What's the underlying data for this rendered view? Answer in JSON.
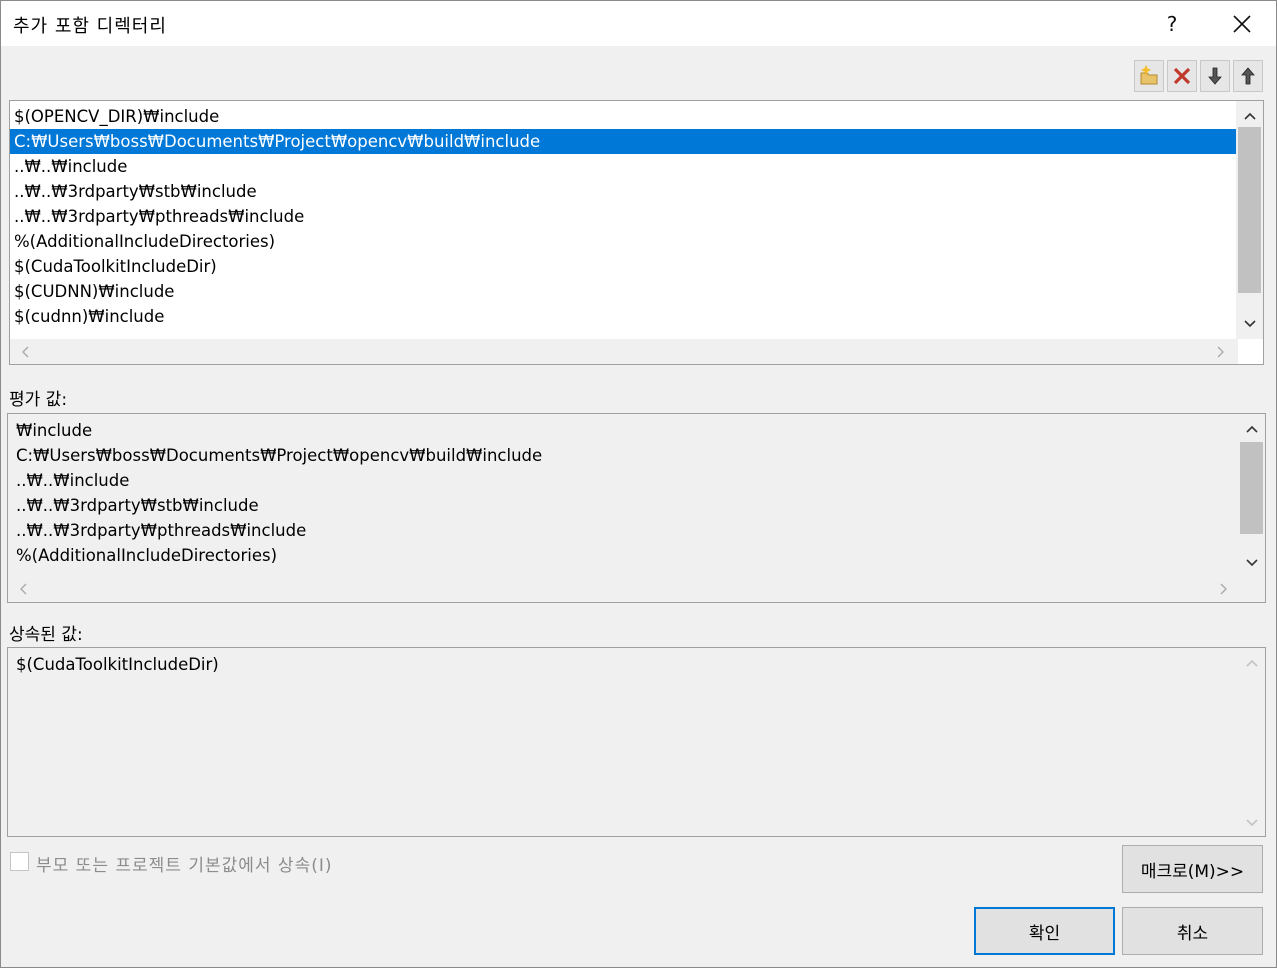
{
  "window": {
    "title": "추가 포함 디렉터리",
    "help_label": "?",
    "close_icon": "close-icon"
  },
  "toolbar": {
    "buttons": [
      {
        "name": "new-line",
        "icon": "new-folder-icon"
      },
      {
        "name": "delete",
        "icon": "delete-x-icon"
      },
      {
        "name": "move-down",
        "icon": "arrow-down-icon"
      },
      {
        "name": "move-up",
        "icon": "arrow-up-icon"
      }
    ]
  },
  "directories": {
    "items": [
      "$(OPENCV_DIR)₩include",
      "C:₩Users₩boss₩Documents₩Project₩opencv₩build₩include",
      "..₩..₩include",
      "..₩..₩3rdparty₩stb₩include",
      "..₩..₩3rdparty₩pthreads₩include",
      "%(AdditionalIncludeDirectories)",
      "$(CudaToolkitIncludeDir)",
      "$(CUDNN)₩include",
      "$(cudnn)₩include"
    ],
    "selected_index": 1
  },
  "evaluated": {
    "label": "평가 값:",
    "items": [
      "₩include",
      "C:₩Users₩boss₩Documents₩Project₩opencv₩build₩include",
      "..₩..₩include",
      "..₩..₩3rdparty₩stb₩include",
      "..₩..₩3rdparty₩pthreads₩include",
      "%(AdditionalIncludeDirectories)"
    ]
  },
  "inherited": {
    "label": "상속된 값:",
    "items": [
      "$(CudaToolkitIncludeDir)"
    ]
  },
  "inherit_checkbox": {
    "label": "부모 또는 프로젝트 기본값에서 상속(I)",
    "checked": false
  },
  "buttons": {
    "macros": "매크로(M)>>",
    "ok": "확인",
    "cancel": "취소"
  },
  "colors": {
    "selection": "#0078d7",
    "delete_icon": "#c0392b"
  }
}
